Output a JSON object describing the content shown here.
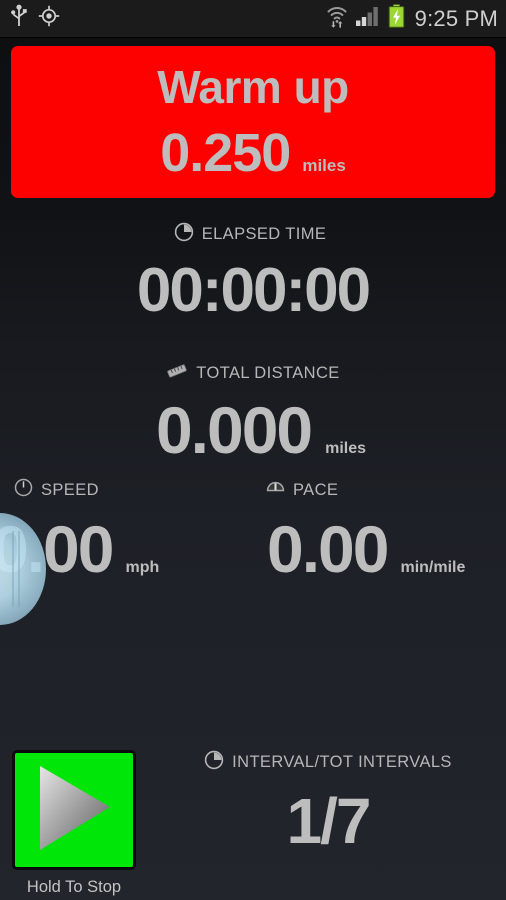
{
  "status_bar": {
    "icons_left": [
      "usb-icon",
      "gps-location-icon"
    ],
    "icons_right": [
      "wifi-icon",
      "signal-bars-icon",
      "battery-charging-icon"
    ],
    "time": "9:25 PM"
  },
  "banner": {
    "title": "Warm up",
    "value": "0.250",
    "unit": "miles",
    "color": "#fd0000",
    "text_color": "#bdbdbd"
  },
  "elapsed": {
    "icon": "clock-icon",
    "label": "ELAPSED TIME",
    "value": "00:00:00"
  },
  "distance": {
    "icon": "ruler-icon",
    "label": "TOTAL DISTANCE",
    "value": "0.000",
    "unit": "miles"
  },
  "speed": {
    "icon": "gauge-icon",
    "label": "SPEED",
    "value": "0.00",
    "unit": "mph"
  },
  "pace": {
    "icon": "pace-gauge-icon",
    "label": "PACE",
    "value": "0.00",
    "unit": "min/mile"
  },
  "interval": {
    "icon": "clock-icon",
    "label": "INTERVAL/TOT INTERVALS",
    "value": "1/7"
  },
  "controls": {
    "play_icon": "play-triangle-icon",
    "play_caption": "Hold To Stop",
    "play_color": "#00e609"
  }
}
